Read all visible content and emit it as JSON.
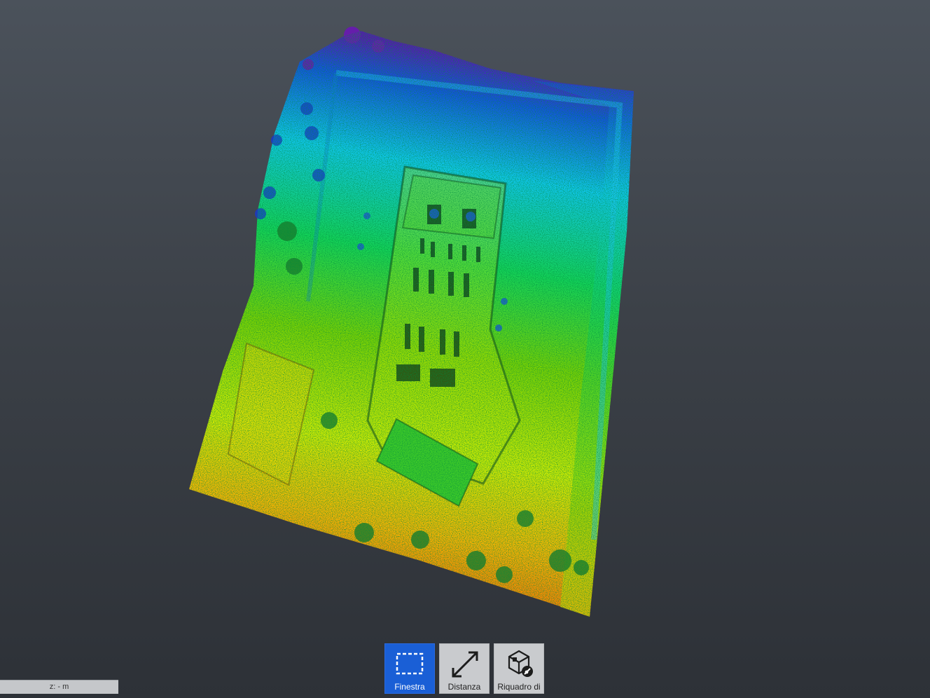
{
  "colors": {
    "background_top": "#4b525b",
    "background_bottom": "#2d3137",
    "active_tool": "#1a5fd6",
    "inactive_tool": "#c9cbce",
    "elevation_ramp": [
      "#5a14b4",
      "#1450e6",
      "#10c8f0",
      "#14d65a",
      "#7ed400",
      "#d4ee00",
      "#ffb400",
      "#ff5a00"
    ]
  },
  "point_cloud": {
    "color_mode": "elevation",
    "view": "top-down"
  },
  "toolbar": {
    "tools": [
      {
        "label": "Finestra",
        "icon": "selection-window-icon",
        "active": true
      },
      {
        "label": "Distanza",
        "icon": "distance-measure-icon",
        "active": false
      },
      {
        "label": "Riquadro di",
        "icon": "bounding-box-icon",
        "active": false
      }
    ]
  },
  "status": {
    "z_readout": "z:  - m"
  }
}
